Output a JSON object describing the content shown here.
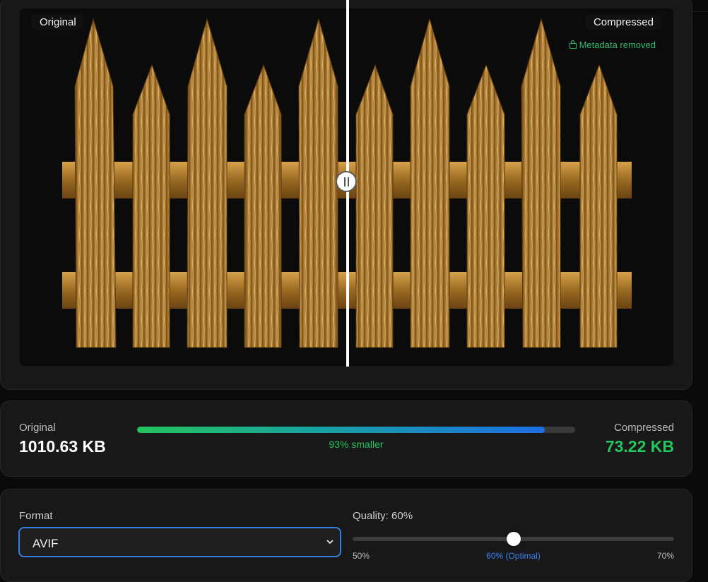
{
  "compare": {
    "original_label": "Original",
    "compressed_label": "Compressed",
    "metadata_text": "Metadata removed"
  },
  "stats": {
    "original_label": "Original",
    "original_size": "1010.63 KB",
    "compressed_label": "Compressed",
    "compressed_size": "73.22 KB",
    "savings_text": "93% smaller",
    "savings_fraction": 0.93
  },
  "settings": {
    "format_label": "Format",
    "format_value": "AVIF",
    "quality_label": "Quality: 60%",
    "quality_value": 60,
    "quality_min": 50,
    "quality_max": 70,
    "quality_min_label": "50%",
    "quality_mid_label": "60% (Optimal)",
    "quality_max_label": "70%"
  },
  "colors": {
    "accent_green": "#22c55e",
    "accent_blue": "#3b82f6",
    "select_border": "#2f7fe6",
    "wood": "#b07e2c"
  },
  "icons": [
    "lock-icon",
    "slider-grip-icon",
    "chevron-down-icon"
  ]
}
